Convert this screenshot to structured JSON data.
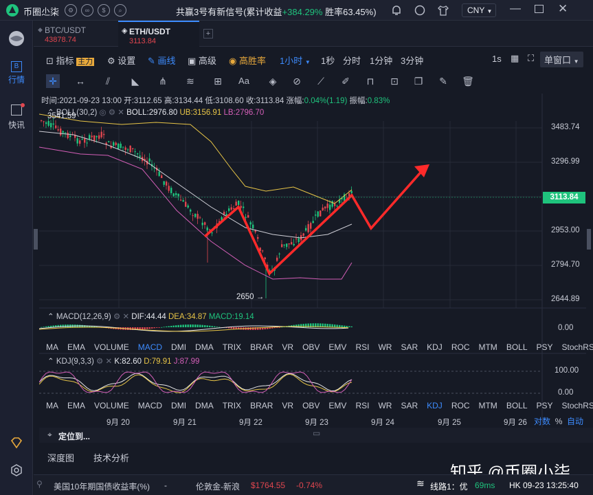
{
  "app": {
    "name": "币圈尐柒"
  },
  "signal": {
    "prefix": "共赢3号有新信号(累计收益",
    "gain": "+384.29%",
    "winrate": "胜率63.45%)"
  },
  "currency": "CNY",
  "sidebar": {
    "items": [
      {
        "label": "行情"
      },
      {
        "label": "快讯"
      }
    ]
  },
  "tabs": [
    {
      "name": "BTC/USDT",
      "price": "43878.74"
    },
    {
      "name": "ETH/USDT",
      "price": "3113.84"
    }
  ],
  "toolbar": {
    "indicator": "指标",
    "indicator_tag": "主力",
    "settings": "设置",
    "draw": "画线",
    "advanced": "高级",
    "winrate": "高胜率",
    "interval": "1小时",
    "periods": [
      "1秒",
      "分时",
      "1分钟",
      "3分钟"
    ],
    "speed": "1s",
    "window": "单窗口"
  },
  "drawtools": {
    "text_tool": "Aa"
  },
  "ohlc": {
    "time_label": "时间:",
    "time": "2021-09-23 13:00",
    "open_label": "开:",
    "open": "3112.65",
    "high_label": "高:",
    "high": "3134.44",
    "low_label": "低:",
    "low": "3108.60",
    "close_label": "收:",
    "close": "3113.84",
    "chg_label": "涨幅:",
    "chg": "0.04%(1.19)",
    "amp_label": "振幅:",
    "amp": "0.83%"
  },
  "boll": {
    "name": "BOLL(30,2)",
    "boll": "BOLL:2976.80",
    "ub": "UB:3156.91",
    "lb": "LB:2796.70"
  },
  "price_axis": {
    "labels": [
      "3483.74",
      "3296.99",
      "2953.00",
      "2794.70",
      "2644.89"
    ],
    "current": "3113.84"
  },
  "annotations": {
    "high": "3541.59",
    "low": "2650 →"
  },
  "macd": {
    "name": "MACD(12,26,9)",
    "dif": "DIF:44.44",
    "dea": "DEA:34.87",
    "macd": "MACD:19.14",
    "axis": "0.00"
  },
  "kdj": {
    "name": "KDJ(9,3,3)",
    "k": "K:82.60",
    "d": "D:79.91",
    "j": "J:87.99",
    "axis": [
      "100.00",
      "0.00"
    ]
  },
  "indicator_tabs": [
    "MA",
    "EMA",
    "VOLUME",
    "MACD",
    "DMI",
    "DMA",
    "TRIX",
    "BRAR",
    "VR",
    "OBV",
    "EMV",
    "RSI",
    "WR",
    "SAR",
    "KDJ",
    "ROC",
    "MTM",
    "BOLL",
    "PSY",
    "StochRSI"
  ],
  "dates": [
    "9月 20",
    "9月 21",
    "9月 22",
    "9月 23",
    "9月 24",
    "9月 25",
    "9月 26"
  ],
  "footer_controls": {
    "compare": "对数",
    "percent": "%",
    "auto": "自动"
  },
  "locate": "定位到...",
  "bottom_tabs": [
    "深度图",
    "技术分析"
  ],
  "watermark": "知乎 @币圈小柒",
  "ticker": {
    "item1": "美国10年期国债收益率(%)",
    "item1_val": "-",
    "item2": "伦敦金-新浪",
    "item2_price": "$1764.55",
    "item2_chg": "-0.74%",
    "line_label": "线路1：优",
    "latency": "69ms",
    "clock": "HK 09-23 13:25:40"
  },
  "colors": {
    "up": "#1fc37d",
    "down": "#e0464f",
    "accent": "#3d8bfd",
    "gold": "#e8a93c"
  }
}
